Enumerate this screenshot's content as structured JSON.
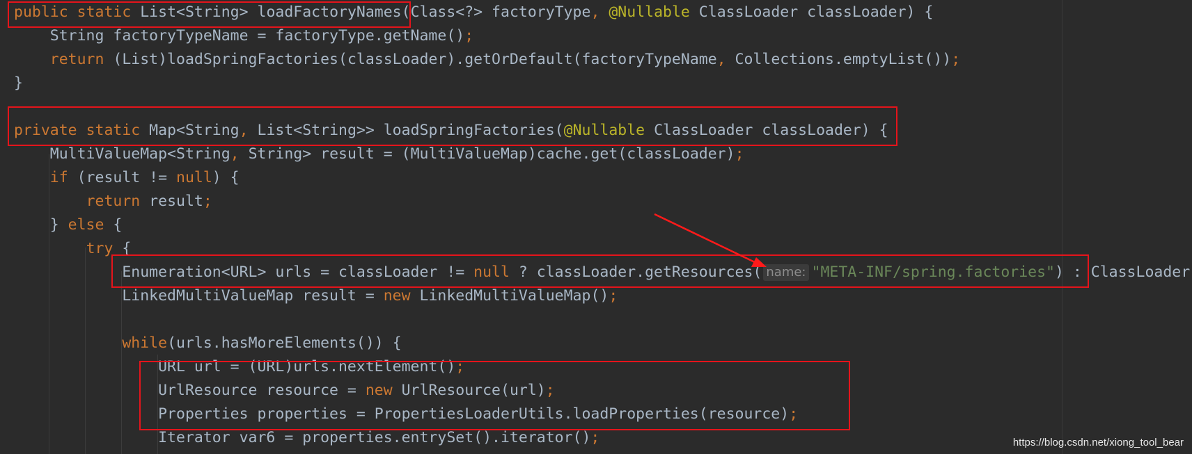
{
  "colors": {
    "background": "#2b2b2b",
    "keyword": "#cc7832",
    "identifier": "#a9b7c6",
    "annotation": "#bbb529",
    "string": "#6a8759",
    "highlight_box": "#e5141b",
    "arrow": "#ff1a1a"
  },
  "code": {
    "lines": [
      [
        {
          "t": "kw",
          "v": "public"
        },
        {
          "t": "plain",
          "v": " "
        },
        {
          "t": "kw",
          "v": "static"
        },
        {
          "t": "plain",
          "v": " List<String> loadFactoryNames(Class<?> factoryType"
        },
        {
          "t": "punc",
          "v": ","
        },
        {
          "t": "plain",
          "v": " "
        },
        {
          "t": "ann",
          "v": "@Nullable"
        },
        {
          "t": "plain",
          "v": " ClassLoader classLoader) {"
        }
      ],
      [
        {
          "t": "plain",
          "v": "    String factoryTypeName = factoryType.getName()"
        },
        {
          "t": "punc",
          "v": ";"
        }
      ],
      [
        {
          "t": "plain",
          "v": "    "
        },
        {
          "t": "kw",
          "v": "return"
        },
        {
          "t": "plain",
          "v": " (List)loadSpringFactories(classLoader).getOrDefault(factoryTypeName"
        },
        {
          "t": "punc",
          "v": ","
        },
        {
          "t": "plain",
          "v": " Collections.emptyList())"
        },
        {
          "t": "punc",
          "v": ";"
        }
      ],
      [
        {
          "t": "plain",
          "v": "}"
        }
      ],
      [],
      [
        {
          "t": "kw",
          "v": "private"
        },
        {
          "t": "plain",
          "v": " "
        },
        {
          "t": "kw",
          "v": "static"
        },
        {
          "t": "plain",
          "v": " Map<String"
        },
        {
          "t": "punc",
          "v": ","
        },
        {
          "t": "plain",
          "v": " List<String>> loadSpringFactories("
        },
        {
          "t": "ann",
          "v": "@Nullable"
        },
        {
          "t": "plain",
          "v": " ClassLoader classLoader) {"
        }
      ],
      [
        {
          "t": "plain",
          "v": "    MultiValueMap<String"
        },
        {
          "t": "punc",
          "v": ","
        },
        {
          "t": "plain",
          "v": " String> result = (MultiValueMap)cache.get(classLoader)"
        },
        {
          "t": "punc",
          "v": ";"
        }
      ],
      [
        {
          "t": "plain",
          "v": "    "
        },
        {
          "t": "kw",
          "v": "if"
        },
        {
          "t": "plain",
          "v": " (result != "
        },
        {
          "t": "kw",
          "v": "null"
        },
        {
          "t": "plain",
          "v": ") {"
        }
      ],
      [
        {
          "t": "plain",
          "v": "        "
        },
        {
          "t": "kw",
          "v": "return"
        },
        {
          "t": "plain",
          "v": " result"
        },
        {
          "t": "punc",
          "v": ";"
        }
      ],
      [
        {
          "t": "plain",
          "v": "    } "
        },
        {
          "t": "kw",
          "v": "else"
        },
        {
          "t": "plain",
          "v": " {"
        }
      ],
      [
        {
          "t": "plain",
          "v": "        "
        },
        {
          "t": "kw",
          "v": "try"
        },
        {
          "t": "plain",
          "v": " {"
        }
      ],
      [
        {
          "t": "plain",
          "v": "            Enumeration<URL> urls = classLoader != "
        },
        {
          "t": "kw",
          "v": "null"
        },
        {
          "t": "plain",
          "v": " ? classLoader.getResources("
        },
        {
          "t": "hint",
          "v": "name:"
        },
        {
          "t": "str",
          "v": "\"META-INF/spring.factories\""
        },
        {
          "t": "plain",
          "v": ") : ClassLoader"
        }
      ],
      [
        {
          "t": "plain",
          "v": "            LinkedMultiValueMap result = "
        },
        {
          "t": "kw",
          "v": "new"
        },
        {
          "t": "plain",
          "v": " LinkedMultiValueMap()"
        },
        {
          "t": "punc",
          "v": ";"
        }
      ],
      [],
      [
        {
          "t": "plain",
          "v": "            "
        },
        {
          "t": "kw",
          "v": "while"
        },
        {
          "t": "plain",
          "v": "(urls.hasMoreElements()) {"
        }
      ],
      [
        {
          "t": "plain",
          "v": "                URL url = (URL)urls.nextElement()"
        },
        {
          "t": "punc",
          "v": ";"
        }
      ],
      [
        {
          "t": "plain",
          "v": "                UrlResource resource = "
        },
        {
          "t": "kw",
          "v": "new"
        },
        {
          "t": "plain",
          "v": " UrlResource(url)"
        },
        {
          "t": "punc",
          "v": ";"
        }
      ],
      [
        {
          "t": "plain",
          "v": "                Properties properties = PropertiesLoaderUtils.loadProperties(resource)"
        },
        {
          "t": "punc",
          "v": ";"
        }
      ],
      [
        {
          "t": "plain",
          "v": "                Iterator var6 = properties.entrySet().iterator()"
        },
        {
          "t": "punc",
          "v": ";"
        }
      ]
    ]
  },
  "watermark": "https://blog.csdn.net/xiong_tool_bear"
}
